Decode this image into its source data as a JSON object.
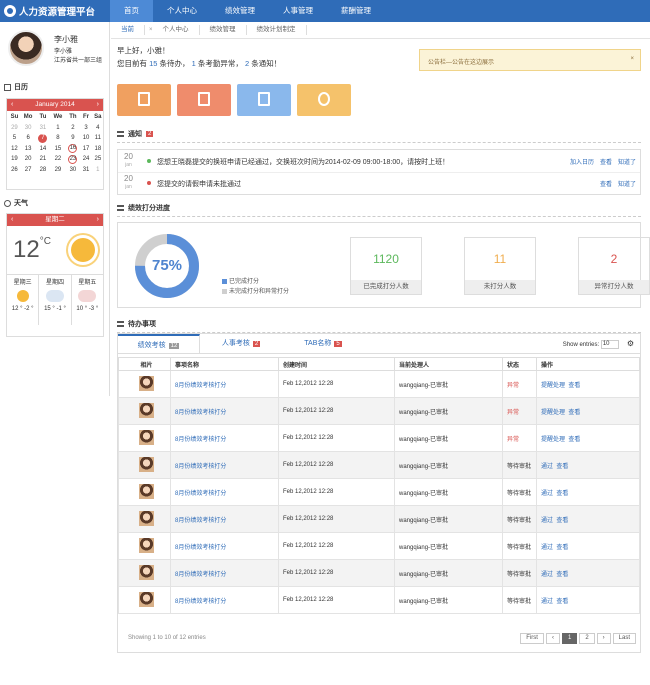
{
  "app": {
    "title": "人力资源管理平台"
  },
  "nav": [
    "首页",
    "个人中心",
    "绩效管理",
    "人事管理",
    "薪酬管理"
  ],
  "user": {
    "name": "李小雅",
    "sub1": "李小雅",
    "sub2": "江苏省共一部三组"
  },
  "calendar": {
    "section": "日历",
    "month": "January 2014",
    "prev": "‹",
    "next": "›",
    "days": [
      "Su",
      "Mo",
      "Tu",
      "We",
      "Th",
      "Fr",
      "Sa"
    ],
    "rows": [
      [
        "29",
        "30",
        "31",
        "1",
        "2",
        "3",
        "4"
      ],
      [
        "5",
        "6",
        "7",
        "8",
        "9",
        "10",
        "11"
      ],
      [
        "12",
        "13",
        "14",
        "15",
        "16",
        "17",
        "18"
      ],
      [
        "19",
        "20",
        "21",
        "22",
        "23",
        "24",
        "25"
      ],
      [
        "26",
        "27",
        "28",
        "29",
        "30",
        "31",
        "1"
      ]
    ]
  },
  "weather": {
    "section": "天气",
    "day": "星期二",
    "temp": "12",
    "unit": "°C",
    "forecast": [
      {
        "day": "星期三",
        "range": "12 ° -2 °",
        "icon": "sun-cloud-icon"
      },
      {
        "day": "星期四",
        "range": "15 ° -1 °",
        "icon": "cloud-rain-icon"
      },
      {
        "day": "星期五",
        "range": "10 ° -3 °",
        "icon": "cloud-rain-icon"
      }
    ]
  },
  "subbar": {
    "tabs": [
      "当前",
      "个人中心",
      "绩效管理",
      "绩效计划制定"
    ],
    "x": "×"
  },
  "greeting": {
    "line1": "早上好，小雅！",
    "pre": "您目前有",
    "n1": "15",
    "t1": "条待办，",
    "n2": "1",
    "t2": "条考勤异常，",
    "n3": "2",
    "t3": "条通知！"
  },
  "notice": {
    "text": "公告栏—公告在这边展示",
    "close": "×"
  },
  "tiles": [
    {
      "color": "#f0a060",
      "icon": "clipboard-icon"
    },
    {
      "color": "#ef8c6c",
      "icon": "clipboard-check-icon"
    },
    {
      "color": "#8ab8ec",
      "icon": "edit-icon"
    },
    {
      "color": "#f5c26b",
      "icon": "award-icon"
    }
  ],
  "notifications": {
    "title": "通知",
    "count": "2",
    "items": [
      {
        "day": "20",
        "mon": "jan",
        "dot": "#5cb85c",
        "text": "您想王晓磊提交的换班申请已经通过，交换班次时间为2014-02-09 09:00-18:00，请按时上班！",
        "actions": [
          "加入日历",
          "查看",
          "知道了"
        ]
      },
      {
        "day": "20",
        "mon": "jan",
        "dot": "#d9534f",
        "text": "您提交的请假申请未批通过",
        "actions": [
          "查看",
          "知道了"
        ]
      }
    ]
  },
  "performance": {
    "title": "绩效打分进度",
    "percent": "75%",
    "legend": [
      "已完成打分",
      "未完成打分和异常打分"
    ],
    "stats": [
      {
        "value": "1120",
        "label": "已完成打分人数",
        "color": "#5cb85c"
      },
      {
        "value": "11",
        "label": "未打分人数",
        "color": "#f0ad4e"
      },
      {
        "value": "2",
        "label": "异常打分人数",
        "color": "#d9534f"
      }
    ],
    "fill": 0.75
  },
  "todo": {
    "title": "待办事项",
    "tabs": [
      {
        "label": "绩效考核",
        "count": "12",
        "color": "#999"
      },
      {
        "label": "人事考核",
        "count": "2",
        "color": "#d9534f"
      },
      {
        "label": "TAB名称",
        "count": "5",
        "color": "#d9534f"
      }
    ],
    "show_entries": "Show entries:",
    "entries": "10",
    "columns": [
      "相片",
      "事项名称",
      "创建时间",
      "当前处理人",
      "状态",
      "操作"
    ],
    "rows": [
      {
        "name": "8月份绩效考核打分",
        "time": "Feb 12,2012 12:28",
        "handler": "wangqiang-已审批",
        "status": "异常",
        "actions": [
          "提醒处理",
          "查看"
        ]
      },
      {
        "name": "8月份绩效考核打分",
        "time": "Feb 12,2012 12:28",
        "handler": "wangqiang-已审批",
        "status": "异常",
        "actions": [
          "提醒处理",
          "查看"
        ]
      },
      {
        "name": "8月份绩效考核打分",
        "time": "Feb 12,2012 12:28",
        "handler": "wangqiang-已审批",
        "status": "异常",
        "actions": [
          "提醒处理",
          "查看"
        ]
      },
      {
        "name": "8月份绩效考核打分",
        "time": "Feb 12,2012 12:28",
        "handler": "wangqiang-已审批",
        "status": "等待审批",
        "actions": [
          "通过",
          "查看"
        ]
      },
      {
        "name": "8月份绩效考核打分",
        "time": "Feb 12,2012 12:28",
        "handler": "wangqiang-已审批",
        "status": "等待审批",
        "actions": [
          "通过",
          "查看"
        ]
      },
      {
        "name": "8月份绩效考核打分",
        "time": "Feb 12,2012 12:28",
        "handler": "wangqiang-已审批",
        "status": "等待审批",
        "actions": [
          "通过",
          "查看"
        ]
      },
      {
        "name": "8月份绩效考核打分",
        "time": "Feb 12,2012 12:28",
        "handler": "wangqiang-已审批",
        "status": "等待审批",
        "actions": [
          "通过",
          "查看"
        ]
      },
      {
        "name": "8月份绩效考核打分",
        "time": "Feb 12,2012 12:28",
        "handler": "wangqiang-已审批",
        "status": "等待审批",
        "actions": [
          "通过",
          "查看"
        ]
      },
      {
        "name": "8月份绩效考核打分",
        "time": "Feb 12,2012 12:28",
        "handler": "wangqiang-已审批",
        "status": "等待审批",
        "actions": [
          "通过",
          "查看"
        ]
      }
    ],
    "footer": "Showing 1 to 10 of 12 entries",
    "pager": [
      "First",
      "‹",
      "1",
      "2",
      "›",
      "Last"
    ]
  }
}
